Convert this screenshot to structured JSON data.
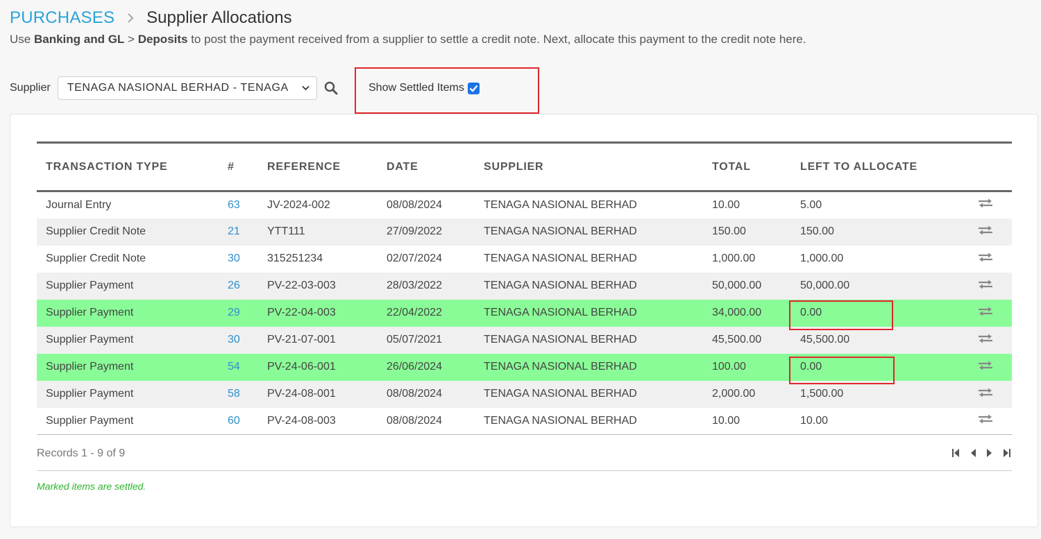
{
  "breadcrumb": {
    "root": "PURCHASES",
    "current": "Supplier Allocations"
  },
  "instructions": {
    "prefix": "Use ",
    "bold1": "Banking and GL",
    "sep": " > ",
    "bold2": "Deposits",
    "suffix": " to post the payment received from a supplier to settle a credit note. Next, allocate this payment to the credit note here."
  },
  "filters": {
    "supplier_label": "Supplier",
    "supplier_value": "TENAGA NASIONAL BERHAD  - TENAGA",
    "show_settled_label": "Show Settled Items",
    "show_settled_checked": true
  },
  "table": {
    "columns": [
      "TRANSACTION TYPE",
      "#",
      "REFERENCE",
      "DATE",
      "SUPPLIER",
      "TOTAL",
      "LEFT TO ALLOCATE"
    ],
    "rows": [
      {
        "type": "Journal Entry",
        "num": "63",
        "ref": "JV-2024-002",
        "date": "08/08/2024",
        "supplier": "TENAGA NASIONAL BERHAD",
        "total": "10.00",
        "left": "5.00",
        "settled": false
      },
      {
        "type": "Supplier Credit Note",
        "num": "21",
        "ref": "YTT111",
        "date": "27/09/2022",
        "supplier": "TENAGA NASIONAL BERHAD",
        "total": "150.00",
        "left": "150.00",
        "settled": false
      },
      {
        "type": "Supplier Credit Note",
        "num": "30",
        "ref": "315251234",
        "date": "02/07/2024",
        "supplier": "TENAGA NASIONAL BERHAD",
        "total": "1,000.00",
        "left": "1,000.00",
        "settled": false
      },
      {
        "type": "Supplier Payment",
        "num": "26",
        "ref": "PV-22-03-003",
        "date": "28/03/2022",
        "supplier": "TENAGA NASIONAL BERHAD",
        "total": "50,000.00",
        "left": "50,000.00",
        "settled": false
      },
      {
        "type": "Supplier Payment",
        "num": "29",
        "ref": "PV-22-04-003",
        "date": "22/04/2022",
        "supplier": "TENAGA NASIONAL BERHAD",
        "total": "34,000.00",
        "left": "0.00",
        "settled": true
      },
      {
        "type": "Supplier Payment",
        "num": "30",
        "ref": "PV-21-07-001",
        "date": "05/07/2021",
        "supplier": "TENAGA NASIONAL BERHAD",
        "total": "45,500.00",
        "left": "45,500.00",
        "settled": false
      },
      {
        "type": "Supplier Payment",
        "num": "54",
        "ref": "PV-24-06-001",
        "date": "26/06/2024",
        "supplier": "TENAGA NASIONAL BERHAD",
        "total": "100.00",
        "left": "0.00",
        "settled": true
      },
      {
        "type": "Supplier Payment",
        "num": "58",
        "ref": "PV-24-08-001",
        "date": "08/08/2024",
        "supplier": "TENAGA NASIONAL BERHAD",
        "total": "2,000.00",
        "left": "1,500.00",
        "settled": false
      },
      {
        "type": "Supplier Payment",
        "num": "60",
        "ref": "PV-24-08-003",
        "date": "08/08/2024",
        "supplier": "TENAGA NASIONAL BERHAD",
        "total": "10.00",
        "left": "10.00",
        "settled": false
      }
    ]
  },
  "records_text": "Records 1 - 9 of 9",
  "legend_note": "Marked items are settled.",
  "colors": {
    "link": "#2aa3d8",
    "settled_row": "#8afc97",
    "highlight": "#e0262c",
    "note": "#2db52d"
  },
  "icons": {
    "breadcrumb_sep": "chevron-right-icon",
    "search": "search-icon",
    "row_action": "swap-arrows-icon"
  }
}
